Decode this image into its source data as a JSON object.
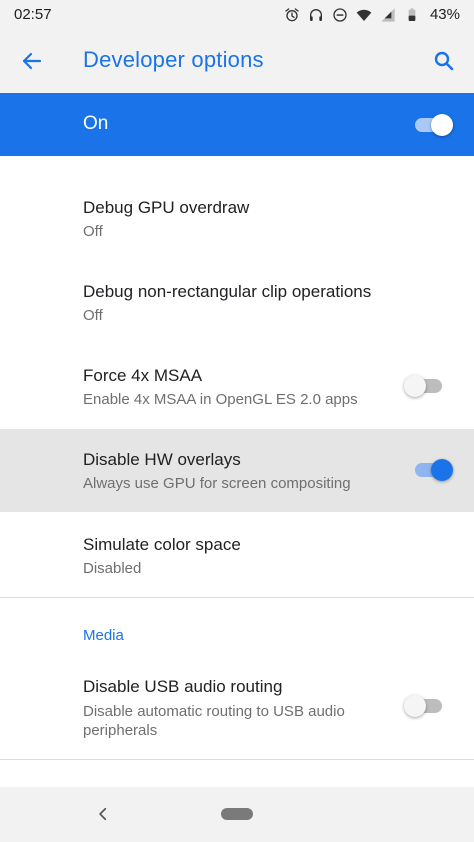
{
  "status_bar": {
    "time": "02:57",
    "battery": "43%"
  },
  "app_bar": {
    "title": "Developer options"
  },
  "master_switch": {
    "label": "On",
    "checked": true
  },
  "settings": [
    {
      "title": "Debug GPU overdraw",
      "summary": "Off"
    },
    {
      "title": "Debug non-rectangular clip operations",
      "summary": "Off"
    },
    {
      "title": "Force 4x MSAA",
      "summary": "Enable 4x MSAA in OpenGL ES 2.0 apps",
      "checked": false
    },
    {
      "title": "Disable HW overlays",
      "summary": "Always use GPU for screen compositing",
      "checked": true
    },
    {
      "title": "Simulate color space",
      "summary": "Disabled"
    }
  ],
  "media": {
    "category_title": "Media",
    "items": [
      {
        "title": "Disable USB audio routing",
        "summary": "Disable automatic routing to USB audio peripherals",
        "checked": false
      }
    ]
  },
  "colors": {
    "accent": "#1a73e8",
    "bar_background": "#f2f2f2",
    "highlight": "#e5e5e5"
  }
}
